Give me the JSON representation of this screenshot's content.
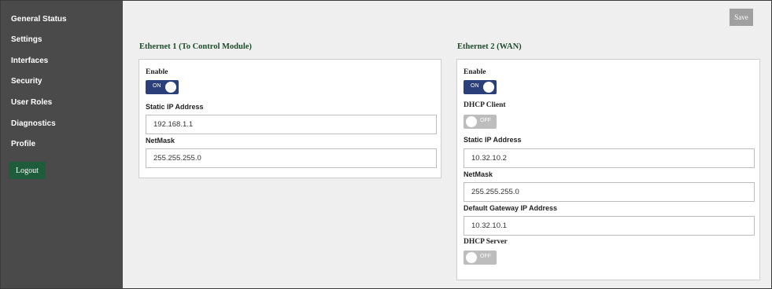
{
  "sidebar": {
    "items": [
      {
        "label": "General Status"
      },
      {
        "label": "Settings"
      },
      {
        "label": "Interfaces"
      },
      {
        "label": "Security"
      },
      {
        "label": "User Roles"
      },
      {
        "label": "Diagnostics"
      },
      {
        "label": "Profile"
      }
    ],
    "logout_label": "Logout"
  },
  "toolbar": {
    "save_label": "Save"
  },
  "toggle_text": {
    "on": "ON",
    "off": "OFF"
  },
  "eth1": {
    "title": "Ethernet 1 (To Control Module)",
    "enable_label": "Enable",
    "enable_state": "on",
    "static_ip_label": "Static IP Address",
    "static_ip": "192.168.1.1",
    "netmask_label": "NetMask",
    "netmask": "255.255.255.0"
  },
  "eth2": {
    "title": "Ethernet 2 (WAN)",
    "enable_label": "Enable",
    "enable_state": "on",
    "dhcp_client_label": "DHCP Client",
    "dhcp_client_state": "off",
    "static_ip_label": "Static IP Address",
    "static_ip": "10.32.10.2",
    "netmask_label": "NetMask",
    "netmask": "255.255.255.0",
    "gateway_label": "Default Gateway IP Address",
    "gateway": "10.32.10.1",
    "dhcp_server_label": "DHCP Server",
    "dhcp_server_state": "off"
  },
  "colors": {
    "sidebar_bg": "#4a4a4a",
    "accent_green": "#1e5c3c",
    "title_green": "#1e4d2b",
    "toggle_on": "#2b3f7a",
    "toggle_off": "#bdbdbd",
    "save_bg": "#a0a0a0"
  }
}
